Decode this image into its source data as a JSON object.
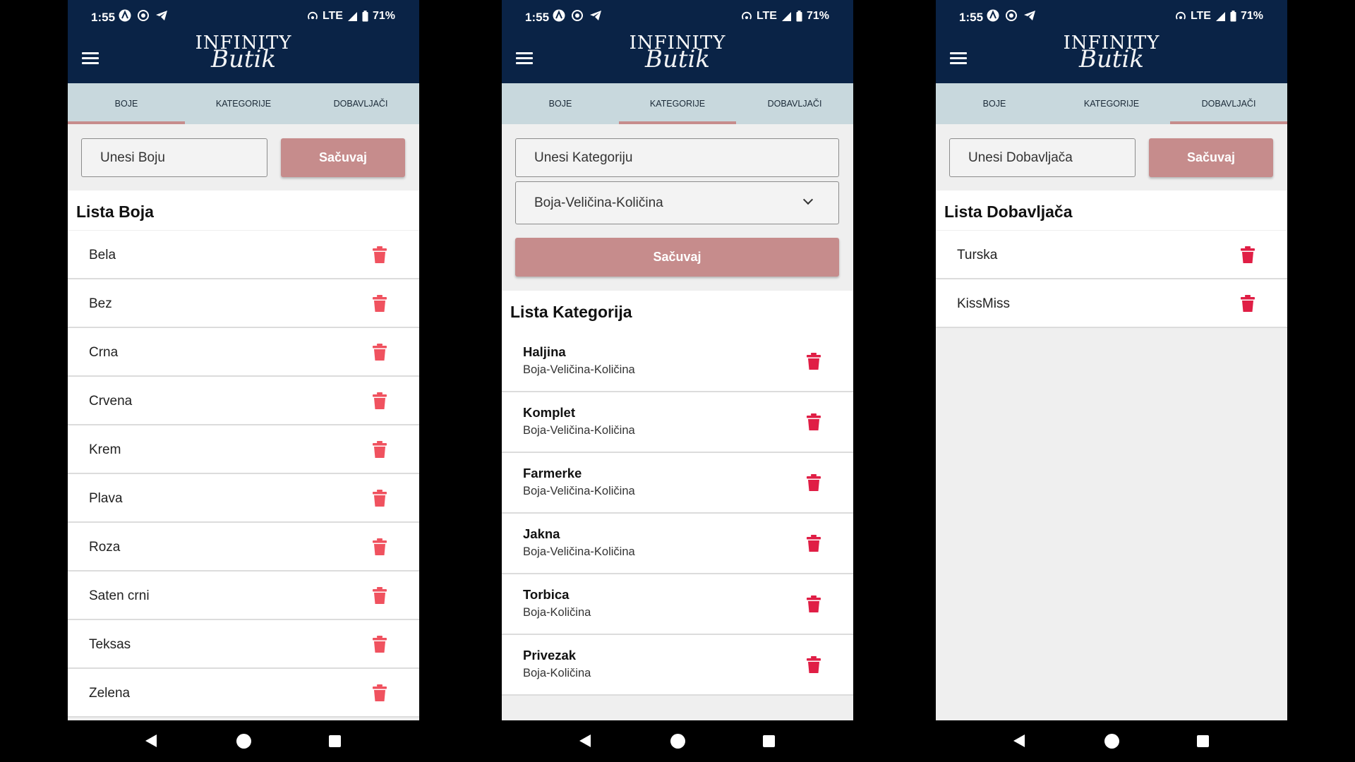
{
  "status": {
    "time": "1:55",
    "network": "LTE",
    "battery": "71%"
  },
  "app": {
    "logo_main": "INFINITY",
    "logo_script": "Butik"
  },
  "tabs": [
    "BOJE",
    "KATEGORIJE",
    "DOBAVLJAČI"
  ],
  "colors": {
    "header": "#0a2346",
    "tabbar": "#c8d8dd",
    "accent": "#c68c8c",
    "trash": "#e01e45"
  },
  "screen1": {
    "input_placeholder": "Unesi Boju",
    "save_label": "Sačuvaj",
    "list_title": "Lista Boja",
    "items": [
      "Bela",
      "Bez",
      "Crna",
      "Crvena",
      "Krem",
      "Plava",
      "Roza",
      "Saten crni",
      "Teksas",
      "Zelena"
    ]
  },
  "screen2": {
    "input_placeholder": "Unesi Kategoriju",
    "dropdown_value": "Boja-Veličina-Količina",
    "save_label": "Sačuvaj",
    "list_title": "Lista Kategorija",
    "items": [
      {
        "name": "Haljina",
        "type": "Boja-Veličina-Količina"
      },
      {
        "name": "Komplet",
        "type": "Boja-Veličina-Količina"
      },
      {
        "name": "Farmerke",
        "type": "Boja-Veličina-Količina"
      },
      {
        "name": "Jakna",
        "type": "Boja-Veličina-Količina"
      },
      {
        "name": "Torbica",
        "type": "Boja-Količina"
      },
      {
        "name": "Privezak",
        "type": "Boja-Količina"
      }
    ]
  },
  "screen3": {
    "input_placeholder": "Unesi Dobavljača",
    "save_label": "Sačuvaj",
    "list_title": "Lista Dobavljača",
    "items": [
      "Turska",
      "KissMiss"
    ]
  }
}
